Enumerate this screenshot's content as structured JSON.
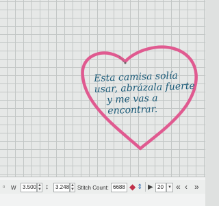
{
  "design": {
    "verse_lines": [
      "Esta camisa solía",
      "usar, abrázala fuerte",
      "y me vas a",
      "encontrar."
    ],
    "heart_color": "#e05a90",
    "text_color": "#1a5a78"
  },
  "toolbar": {
    "width_label": "W",
    "width_value": "3.500",
    "height_value": "3.248",
    "stitch_count_label": "Stitch Count:",
    "stitch_count_value": "6688",
    "page_value": "20"
  }
}
